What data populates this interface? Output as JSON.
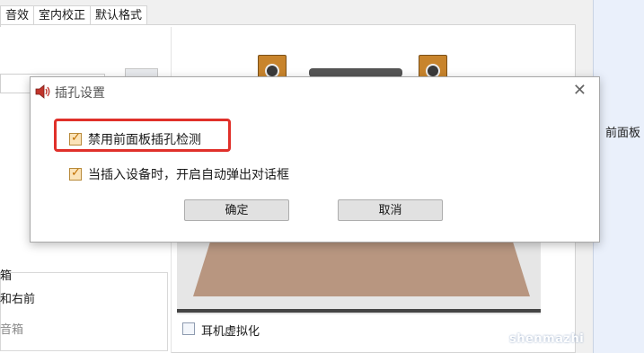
{
  "background": {
    "tabs": [
      "音效",
      "室内校正",
      "默认格式"
    ],
    "speaker_group_title": "箱",
    "speaker_option1": "和右前",
    "speaker_option2": "音箱",
    "right_label": "前面板",
    "headphone_virtualization": "耳机虚拟化",
    "watermark": "shenmazhi"
  },
  "dialog": {
    "title": "插孔设置",
    "option1_label": "禁用前面板插孔检测",
    "option1_checked": true,
    "option2_label": "当插入设备时，开启自动弹出对话框",
    "option2_checked": true,
    "ok_label": "确定",
    "cancel_label": "取消"
  },
  "colors": {
    "highlight": "#e0302a",
    "checkbox_fill": "#fbe3b8",
    "checkmark": "#c06f00"
  },
  "icons": [
    "speaker-icon",
    "close-icon",
    "checkmark-icon"
  ]
}
